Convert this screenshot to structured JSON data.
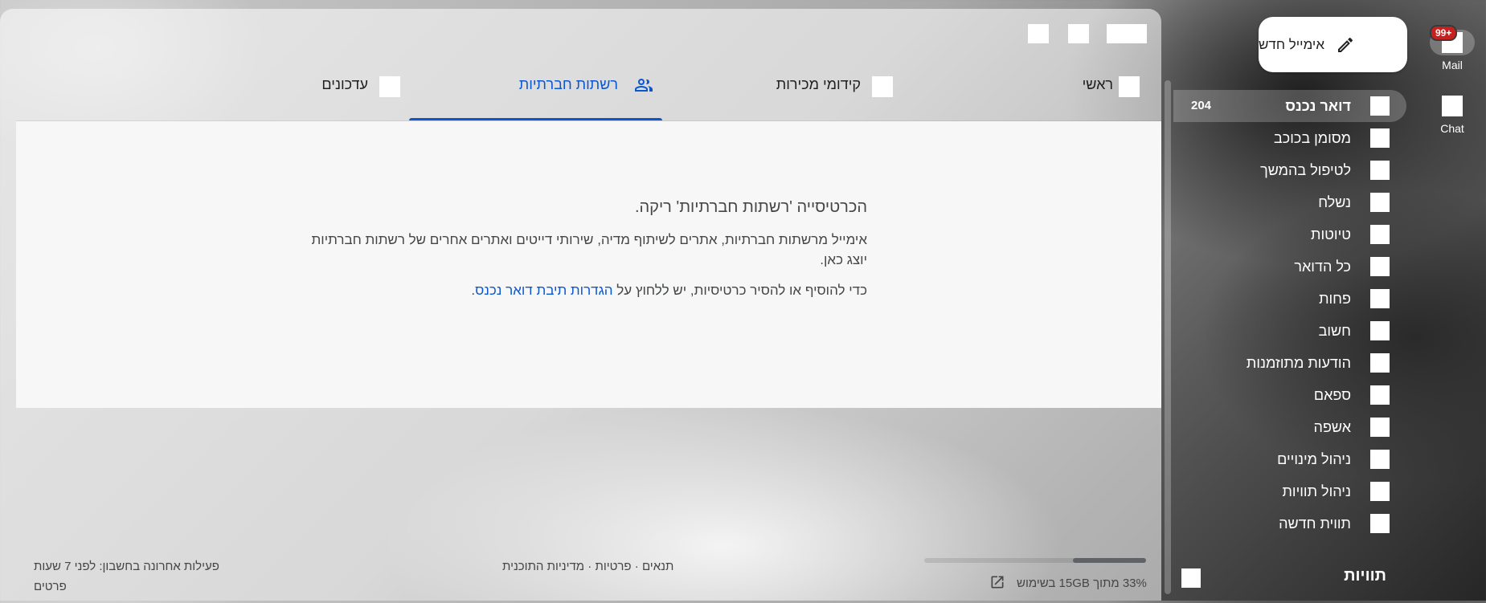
{
  "rail": {
    "mail": {
      "label": "Mail",
      "badge": "99+"
    },
    "chat": {
      "label": "Chat"
    }
  },
  "compose": {
    "label": "אימייל חדש",
    "icon": "pencil-icon"
  },
  "nav": {
    "items": [
      {
        "label": "דואר נכנס",
        "count": "204",
        "active": true
      },
      {
        "label": "מסומן בכוכב"
      },
      {
        "label": "לטיפול בהמשך"
      },
      {
        "label": "נשלח"
      },
      {
        "label": "טיוטות"
      },
      {
        "label": "כל הדואר"
      },
      {
        "label": "פחות"
      },
      {
        "label": "חשוב"
      },
      {
        "label": "הודעות מתוזמנות"
      },
      {
        "label": "ספאם"
      },
      {
        "label": "אשפה"
      },
      {
        "label": "ניהול מינויים"
      },
      {
        "label": "ניהול תוויות"
      },
      {
        "label": "תווית חדשה"
      }
    ]
  },
  "labels": {
    "title": "תוויות"
  },
  "tabs": [
    {
      "label": "ראשי"
    },
    {
      "label": "קידומי מכירות"
    },
    {
      "label": "רשתות חברתיות",
      "icon": "people-icon",
      "active": true
    },
    {
      "label": "עדכונים"
    }
  ],
  "empty_state": {
    "title": "הכרטיסייה 'רשתות חברתיות' ריקה.",
    "description": "אימייל מרשתות חברתיות, אתרים לשיתוף מדיה, שירותי דייטים ואתרים אחרים של רשתות חברתיות יוצג כאן.",
    "hint_prefix": "כדי להוסיף או להסיר כרטיסיות, יש ללחוץ על ",
    "hint_link": "הגדרות תיבת דואר נכנס",
    "hint_suffix": "."
  },
  "footer": {
    "storage_text": "33% מתוך 15GB בשימוש",
    "storage_fraction": 0.33,
    "links": {
      "terms": "תנאים",
      "sep1": " · ",
      "privacy": "פרטיות",
      "sep2": " · ",
      "policy": "מדיניות התוכנית"
    },
    "activity": "פעילות אחרונה בחשבון: לפני 7 שעות",
    "details": "פרטים"
  },
  "colors": {
    "accent": "#0b57d0",
    "badge": "#c5221f"
  }
}
